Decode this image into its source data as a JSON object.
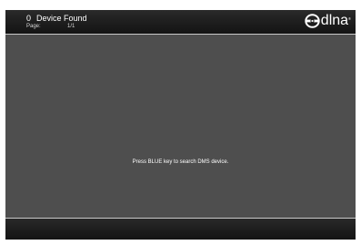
{
  "header": {
    "device_count": "0",
    "title": "Device Found",
    "page_label": "Page:",
    "page_value": "1/1"
  },
  "logo": {
    "text": "dlna",
    "trademark": "®",
    "icon": "dlna-logo-icon"
  },
  "main": {
    "message": "Press BLUE key to search DMS device."
  },
  "colors": {
    "background": "#4e4e4e",
    "bar": "#1c1c1c",
    "divider": "#c9c9c9",
    "text": "#ffffff"
  }
}
